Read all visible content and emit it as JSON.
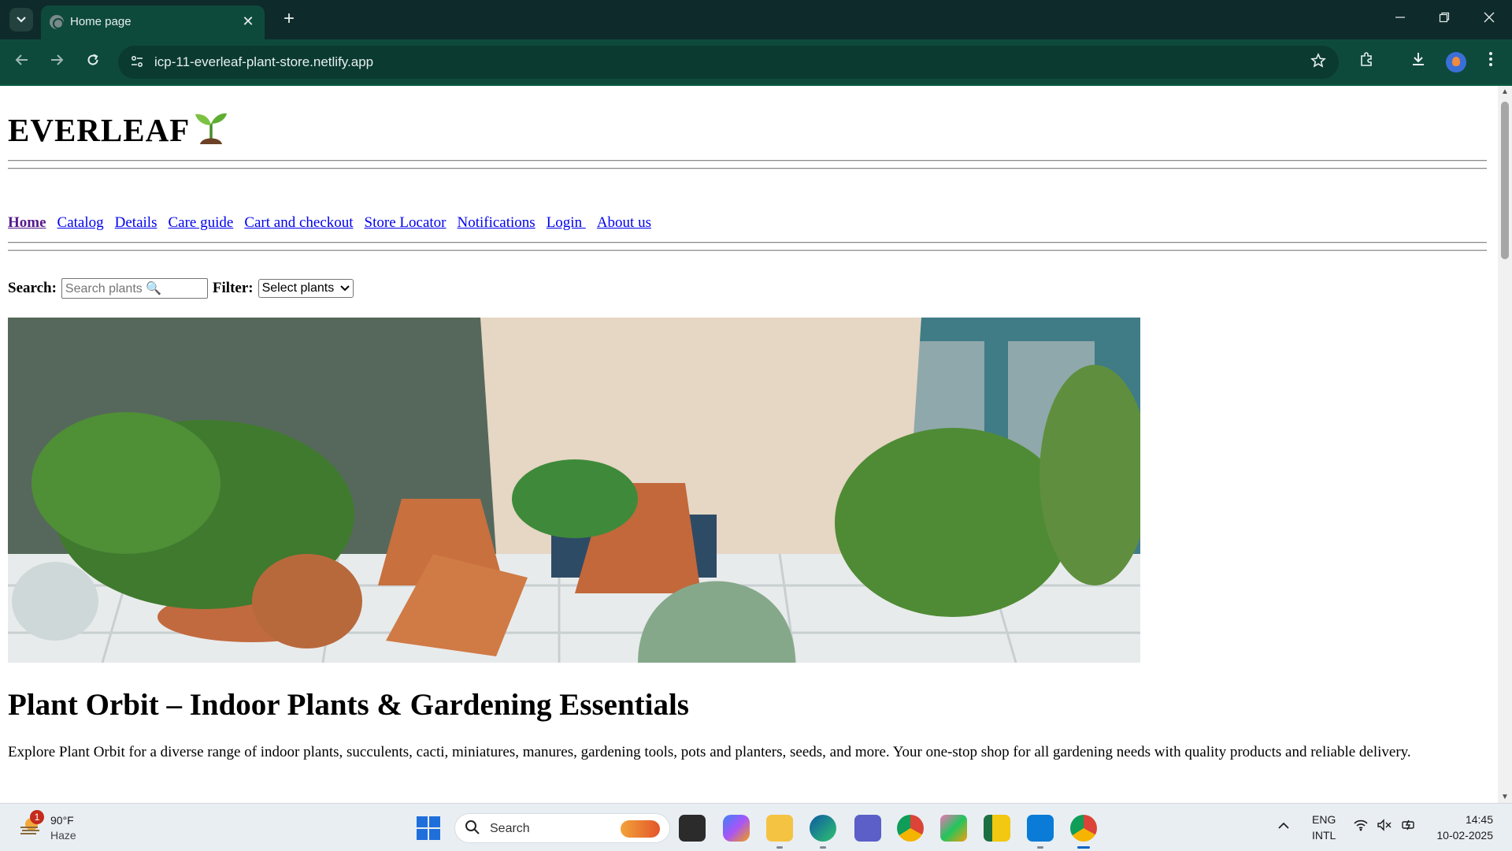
{
  "browser": {
    "tab_title": "Home page",
    "url": "icp-11-everleaf-plant-store.netlify.app",
    "new_tab_label": "+",
    "close_tab_label": "✕"
  },
  "site": {
    "brand": "EVERLEAF",
    "nav": [
      "Home",
      "Catalog",
      "Details",
      "Care guide",
      "Cart and checkout",
      "Store Locator",
      "Notifications",
      "Login ",
      "About us"
    ],
    "search_label": "Search:",
    "search_placeholder": "Search plants 🔍",
    "filter_label": "Filter:",
    "filter_selected": "Select plants",
    "heading": "Plant Orbit – Indoor Plants & Gardening Essentials",
    "description": "Explore Plant Orbit for a diverse range of indoor plants, succulents, cacti, miniatures, manures, gardening tools, pots and planters, seeds, and more. Your one-stop shop for all gardening needs with quality products and reliable delivery."
  },
  "taskbar": {
    "weather_badge": "1",
    "weather_temp": "90°F",
    "weather_cond": "Haze",
    "search_text": "Search",
    "lang_line1": "ENG",
    "lang_line2": "INTL",
    "time": "14:45",
    "date": "10-02-2025"
  },
  "colors": {
    "tabstrip": "#0f2a2a",
    "toolbar": "#0e4a3c",
    "link": "#0000ee",
    "visited_link": "#551a8b"
  }
}
